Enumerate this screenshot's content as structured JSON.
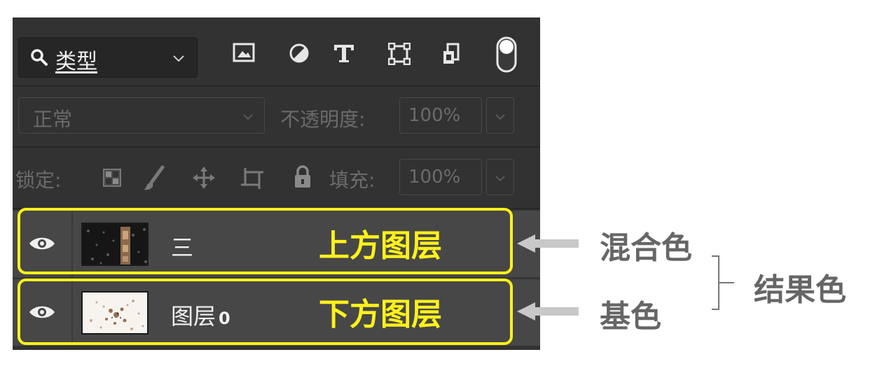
{
  "filter": {
    "label": "类型",
    "icons": [
      "search-icon",
      "chevron-down-icon",
      "image-icon",
      "adjustment-icon",
      "type-icon",
      "shape-icon",
      "smart-object-icon",
      "filter-toggle-icon"
    ]
  },
  "blend": {
    "mode": "正常",
    "opacity_label": "不透明度:",
    "opacity_value": "100%"
  },
  "lock": {
    "label": "锁定:",
    "icons": [
      "lock-transparent-icon",
      "lock-paint-icon",
      "lock-move-icon",
      "lock-artboard-icon",
      "lock-all-icon"
    ],
    "fill_label": "填充:",
    "fill_value": "100%"
  },
  "layers": [
    {
      "name": "三",
      "tag": "上方图层",
      "visible": true
    },
    {
      "name": "图层",
      "name_suffix": "0",
      "tag": "下方图层",
      "visible": true
    }
  ],
  "annotations": {
    "upper": "混合色",
    "lower": "基色",
    "result": "结果色"
  },
  "colors": {
    "panel_bg": "#323232",
    "layer_bg": "#474747",
    "highlight": "#fff21a",
    "annotation_text": "#666666",
    "arrow": "#c8c8c8"
  }
}
